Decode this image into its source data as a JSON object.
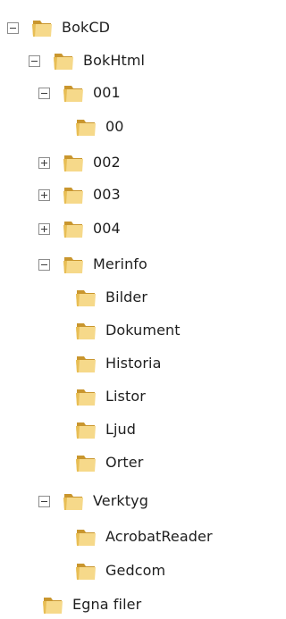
{
  "tree": {
    "items": [
      {
        "label": "BokCD",
        "state": "expanded",
        "icon": "folder-icon"
      },
      {
        "label": "BokHtml",
        "state": "expanded",
        "icon": "folder-icon"
      },
      {
        "label": "001",
        "state": "expanded",
        "icon": "folder-icon"
      },
      {
        "label": "00",
        "state": "leaf",
        "icon": "folder-icon"
      },
      {
        "label": "002",
        "state": "collapsed",
        "icon": "folder-icon"
      },
      {
        "label": "003",
        "state": "collapsed",
        "icon": "folder-icon"
      },
      {
        "label": "004",
        "state": "collapsed",
        "icon": "folder-icon"
      },
      {
        "label": "Merinfo",
        "state": "expanded",
        "icon": "folder-icon"
      },
      {
        "label": "Bilder",
        "state": "leaf",
        "icon": "folder-icon"
      },
      {
        "label": "Dokument",
        "state": "leaf",
        "icon": "folder-icon"
      },
      {
        "label": "Historia",
        "state": "leaf",
        "icon": "folder-icon"
      },
      {
        "label": "Listor",
        "state": "leaf",
        "icon": "folder-icon"
      },
      {
        "label": "Ljud",
        "state": "leaf",
        "icon": "folder-icon"
      },
      {
        "label": "Orter",
        "state": "leaf",
        "icon": "folder-icon"
      },
      {
        "label": "Verktyg",
        "state": "expanded",
        "icon": "folder-icon"
      },
      {
        "label": "AcrobatReader",
        "state": "leaf",
        "icon": "folder-icon"
      },
      {
        "label": "Gedcom",
        "state": "leaf",
        "icon": "folder-icon"
      },
      {
        "label": "Egna filer",
        "state": "leaf",
        "icon": "folder-icon"
      }
    ]
  },
  "colors": {
    "folder_light": "#f6d98a",
    "folder_mid": "#e8be55",
    "folder_dark": "#c9962e",
    "toggle_border": "#8d8d8d",
    "text": "#1e1e1e"
  }
}
